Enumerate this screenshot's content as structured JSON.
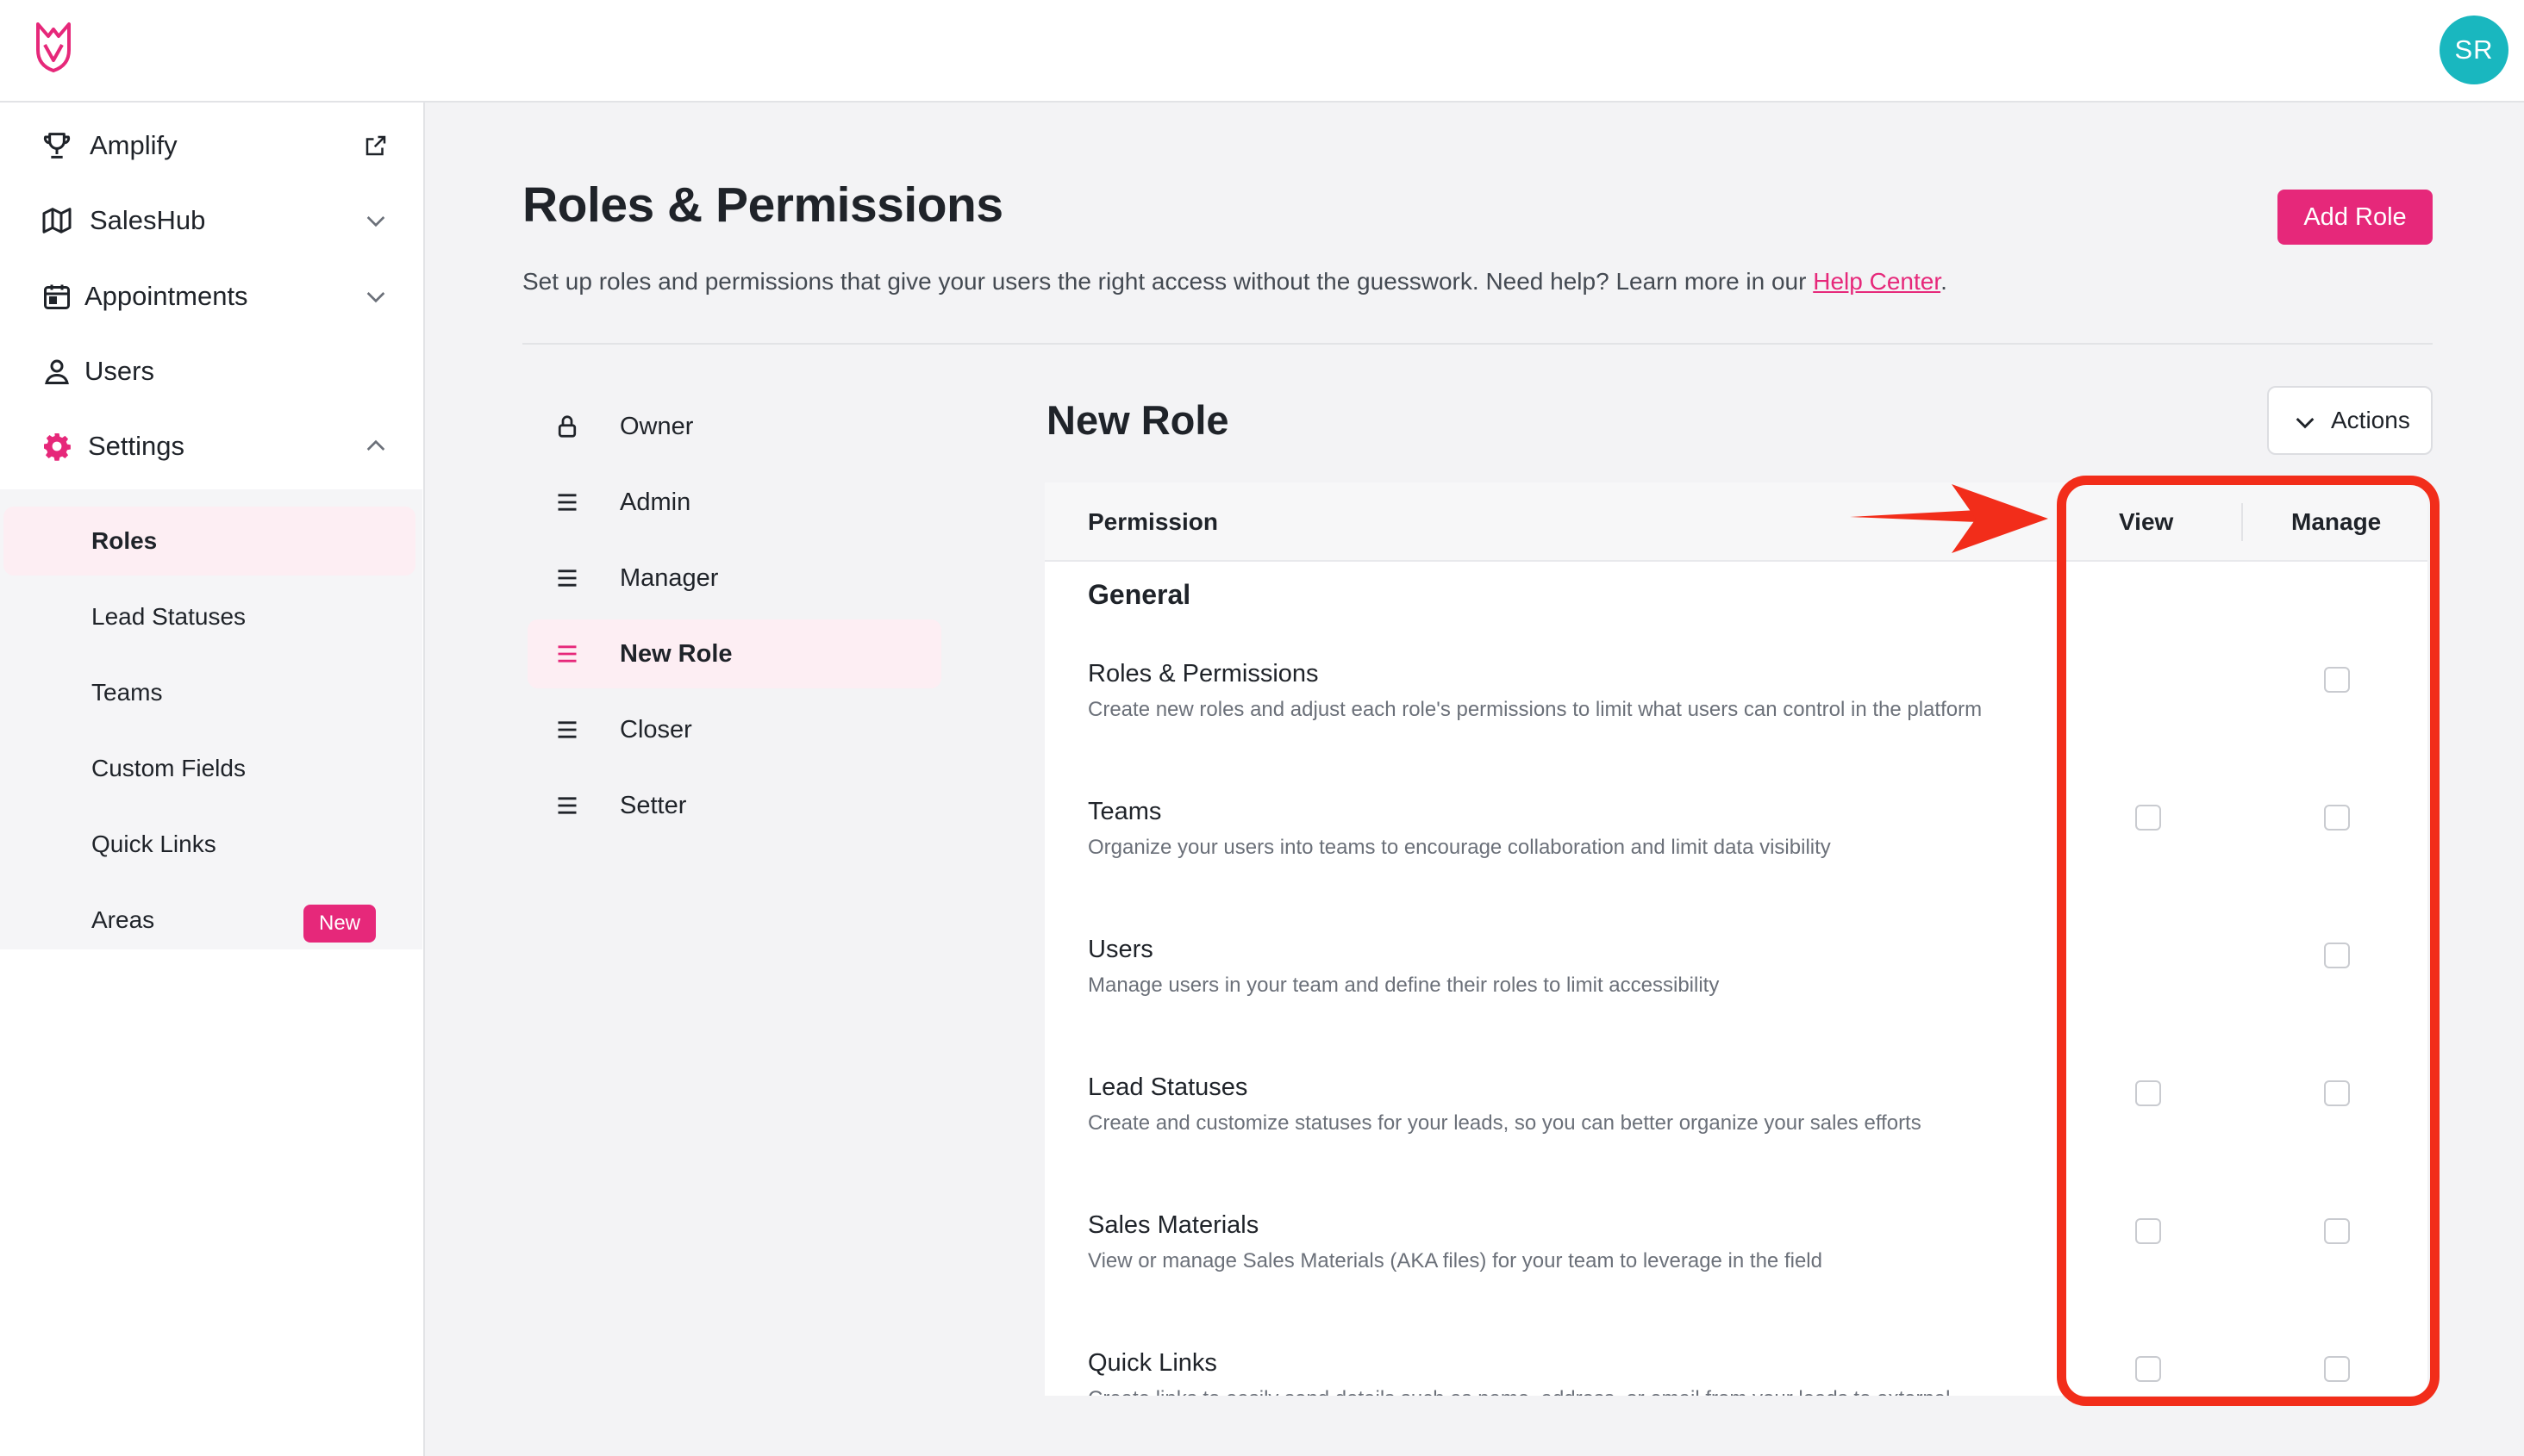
{
  "header": {
    "avatar_initials": "SR",
    "brand_color": "#e6287a",
    "avatar_color": "#19b7bf"
  },
  "sidebar": {
    "items": [
      {
        "label": "Amplify",
        "icon": "trophy-icon",
        "trail": "external-link-icon"
      },
      {
        "label": "SalesHub",
        "icon": "map-icon",
        "trail": "chevron-down-icon"
      },
      {
        "label": "Appointments",
        "icon": "calendar-icon",
        "trail": "chevron-down-icon"
      },
      {
        "label": "Users",
        "icon": "user-icon"
      },
      {
        "label": "Settings",
        "icon": "gear-icon",
        "trail": "chevron-up-icon"
      }
    ],
    "settings_subitems": [
      {
        "label": "Roles",
        "active": true
      },
      {
        "label": "Lead Statuses"
      },
      {
        "label": "Teams"
      },
      {
        "label": "Custom Fields"
      },
      {
        "label": "Quick Links"
      },
      {
        "label": "Areas",
        "badge": "New"
      }
    ]
  },
  "main": {
    "title": "Roles & Permissions",
    "description": "Set up roles and permissions that give your users the right access without the guesswork. Need help? Learn more in our ",
    "help_link": "Help Center",
    "description_end": ".",
    "add_role_label": "Add Role"
  },
  "roles": [
    {
      "label": "Owner",
      "icon": "lock-icon"
    },
    {
      "label": "Admin",
      "icon": "menu-icon"
    },
    {
      "label": "Manager",
      "icon": "menu-icon"
    },
    {
      "label": "New Role",
      "icon": "menu-icon",
      "active": true
    },
    {
      "label": "Closer",
      "icon": "menu-icon"
    },
    {
      "label": "Setter",
      "icon": "menu-icon"
    }
  ],
  "role_detail": {
    "title": "New Role",
    "actions_label": "Actions",
    "columns": {
      "permission": "Permission",
      "view": "View",
      "manage": "Manage"
    },
    "section": "General",
    "permissions": [
      {
        "name": "Roles & Permissions",
        "description": "Create new roles and adjust each role's permissions to limit what users can control in the platform",
        "view": null,
        "manage": false
      },
      {
        "name": "Teams",
        "description": "Organize your users into teams to encourage collaboration and limit data visibility",
        "view": false,
        "manage": false
      },
      {
        "name": "Users",
        "description": "Manage users in your team and define their roles to limit accessibility",
        "view": null,
        "manage": false
      },
      {
        "name": "Lead Statuses",
        "description": "Create and customize statuses for your leads, so you can better organize your sales efforts",
        "view": false,
        "manage": false
      },
      {
        "name": "Sales Materials",
        "description": "View or manage Sales Materials (AKA files) for your team to leverage in the field",
        "view": false,
        "manage": false
      },
      {
        "name": "Quick Links",
        "description": "Create links to easily send details such as name, address, or email from your leads to external",
        "view": false,
        "manage": false
      }
    ]
  },
  "annotation": {
    "color": "#f22d1a"
  }
}
